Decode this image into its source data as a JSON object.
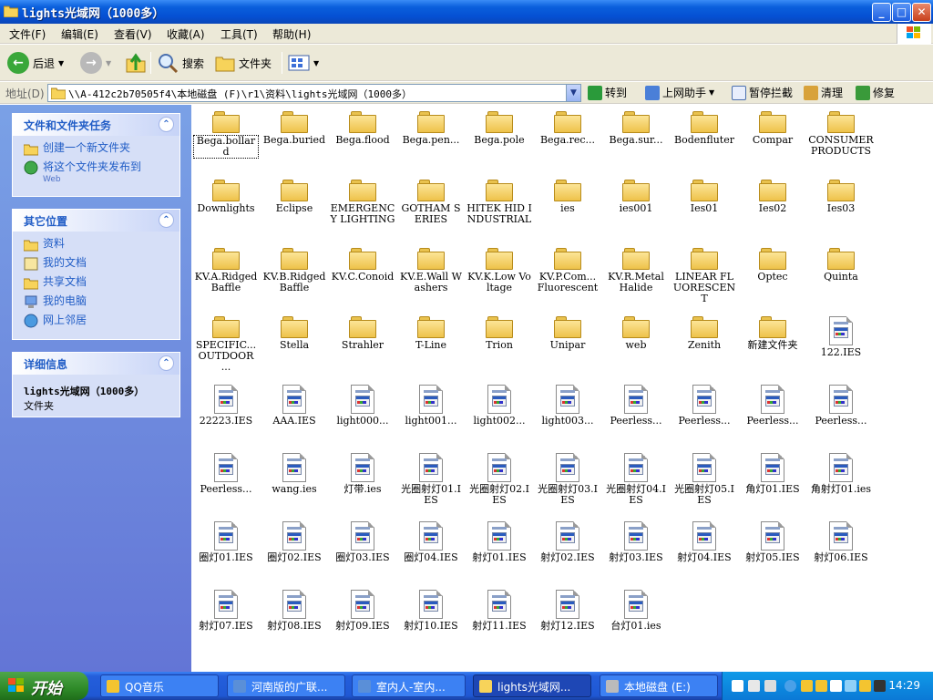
{
  "window": {
    "title": "lights光域网（1000多）",
    "buttons": {
      "minimize": "_",
      "maximize": "□",
      "close": "✕"
    }
  },
  "menu": [
    "文件(F)",
    "编辑(E)",
    "查看(V)",
    "收藏(A)",
    "工具(T)",
    "帮助(H)"
  ],
  "toolbar": {
    "back": "后退",
    "search": "搜索",
    "folders": "文件夹"
  },
  "address": {
    "label": "地址(D)",
    "path": "\\\\A-412c2b70505f4\\本地磁盘 (F)\\r1\\资料\\lights光域网（1000多）",
    "go": "转到",
    "links": [
      "上网助手",
      "暂停拦截",
      "清理",
      "修复"
    ]
  },
  "taskpane": {
    "tasks": {
      "title": "文件和文件夹任务",
      "items": [
        {
          "label": "创建一个新文件夹",
          "sub": ""
        },
        {
          "label": "将这个文件夹发布到",
          "sub": "Web"
        }
      ]
    },
    "places": {
      "title": "其它位置",
      "items": [
        "资料",
        "我的文档",
        "共享文档",
        "我的电脑",
        "网上邻居"
      ]
    },
    "details": {
      "title": "详细信息",
      "name": "lights光域网（1000多）",
      "type": "文件夹"
    }
  },
  "files": [
    {
      "name": "Bega.bollard",
      "kind": "folder"
    },
    {
      "name": "Bega.buried",
      "kind": "folder"
    },
    {
      "name": "Bega.flood",
      "kind": "folder"
    },
    {
      "name": "Bega.pen...",
      "kind": "folder"
    },
    {
      "name": "Bega.pole",
      "kind": "folder"
    },
    {
      "name": "Bega.rec...",
      "kind": "folder"
    },
    {
      "name": "Bega.sur...",
      "kind": "folder"
    },
    {
      "name": "Bodenfluter",
      "kind": "folder"
    },
    {
      "name": "Compar",
      "kind": "folder"
    },
    {
      "name": "CONSUMER PRODUCTS",
      "kind": "folder"
    },
    {
      "name": "Downlights",
      "kind": "folder"
    },
    {
      "name": "Eclipse",
      "kind": "folder"
    },
    {
      "name": "EMERGENCY LIGHTING",
      "kind": "folder"
    },
    {
      "name": "GOTHAM SERIES",
      "kind": "folder"
    },
    {
      "name": "HITEK HID INDUSTRIAL",
      "kind": "folder"
    },
    {
      "name": "ies",
      "kind": "folder"
    },
    {
      "name": "ies001",
      "kind": "folder"
    },
    {
      "name": "Ies01",
      "kind": "folder"
    },
    {
      "name": "Ies02",
      "kind": "folder"
    },
    {
      "name": "Ies03",
      "kind": "folder"
    },
    {
      "name": "KV.A.Ridged Baffle",
      "kind": "folder"
    },
    {
      "name": "KV.B.Ridged Baffle",
      "kind": "folder"
    },
    {
      "name": "KV.C.Conoid",
      "kind": "folder"
    },
    {
      "name": "KV.E.Wall Washers",
      "kind": "folder"
    },
    {
      "name": "KV.K.Low Voltage",
      "kind": "folder"
    },
    {
      "name": "KV.P.Com... Fluorescent",
      "kind": "folder"
    },
    {
      "name": "KV.R.Metal Halide",
      "kind": "folder"
    },
    {
      "name": "LINEAR FLUORESCENT",
      "kind": "folder"
    },
    {
      "name": "Optec",
      "kind": "folder"
    },
    {
      "name": "Quinta",
      "kind": "folder"
    },
    {
      "name": "SPECIFIC... OUTDOOR ...",
      "kind": "folder"
    },
    {
      "name": "Stella",
      "kind": "folder"
    },
    {
      "name": "Strahler",
      "kind": "folder"
    },
    {
      "name": "T-Line",
      "kind": "folder"
    },
    {
      "name": "Trion",
      "kind": "folder"
    },
    {
      "name": "Unipar",
      "kind": "folder"
    },
    {
      "name": "web",
      "kind": "folder"
    },
    {
      "name": "Zenith",
      "kind": "folder"
    },
    {
      "name": "新建文件夹",
      "kind": "folder"
    },
    {
      "name": "122.IES",
      "kind": "file"
    },
    {
      "name": "22223.IES",
      "kind": "file"
    },
    {
      "name": "AAA.IES",
      "kind": "file"
    },
    {
      "name": "light000...",
      "kind": "file"
    },
    {
      "name": "light001...",
      "kind": "file"
    },
    {
      "name": "light002...",
      "kind": "file"
    },
    {
      "name": "light003...",
      "kind": "file"
    },
    {
      "name": "Peerless...",
      "kind": "file"
    },
    {
      "name": "Peerless...",
      "kind": "file"
    },
    {
      "name": "Peerless...",
      "kind": "file"
    },
    {
      "name": "Peerless...",
      "kind": "file"
    },
    {
      "name": "Peerless...",
      "kind": "file"
    },
    {
      "name": "wang.ies",
      "kind": "file"
    },
    {
      "name": "灯带.ies",
      "kind": "file"
    },
    {
      "name": "光圈射灯01.IES",
      "kind": "file"
    },
    {
      "name": "光圈射灯02.IES",
      "kind": "file"
    },
    {
      "name": "光圈射灯03.IES",
      "kind": "file"
    },
    {
      "name": "光圈射灯04.IES",
      "kind": "file"
    },
    {
      "name": "光圈射灯05.IES",
      "kind": "file"
    },
    {
      "name": "角灯01.IES",
      "kind": "file"
    },
    {
      "name": "角射灯01.ies",
      "kind": "file"
    },
    {
      "name": "圈灯01.IES",
      "kind": "file"
    },
    {
      "name": "圈灯02.IES",
      "kind": "file"
    },
    {
      "name": "圈灯03.IES",
      "kind": "file"
    },
    {
      "name": "圈灯04.IES",
      "kind": "file"
    },
    {
      "name": "射灯01.IES",
      "kind": "file"
    },
    {
      "name": "射灯02.IES",
      "kind": "file"
    },
    {
      "name": "射灯03.IES",
      "kind": "file"
    },
    {
      "name": "射灯04.IES",
      "kind": "file"
    },
    {
      "name": "射灯05.IES",
      "kind": "file"
    },
    {
      "name": "射灯06.IES",
      "kind": "file"
    },
    {
      "name": "射灯07.IES",
      "kind": "file"
    },
    {
      "name": "射灯08.IES",
      "kind": "file"
    },
    {
      "name": "射灯09.IES",
      "kind": "file"
    },
    {
      "name": "射灯10.IES",
      "kind": "file"
    },
    {
      "name": "射灯11.IES",
      "kind": "file"
    },
    {
      "name": "射灯12.IES",
      "kind": "file"
    },
    {
      "name": "台灯01.ies",
      "kind": "file"
    }
  ],
  "taskbar": {
    "start": "开始",
    "tasks": [
      {
        "label": "QQ音乐",
        "active": false
      },
      {
        "label": "河南版的广联...",
        "active": false
      },
      {
        "label": "室内人-室内...",
        "active": false
      },
      {
        "label": "lights光域网...",
        "active": true
      },
      {
        "label": "本地磁盘 (E:)",
        "active": false
      }
    ],
    "clock": "14:29"
  },
  "colors": {
    "titlebar": "#0550d3",
    "taskpane_bg": "#6f8fe0",
    "panel_title": "#215dc6",
    "start_green": "#3a9a34",
    "folder_yellow": "#f5d46a"
  }
}
